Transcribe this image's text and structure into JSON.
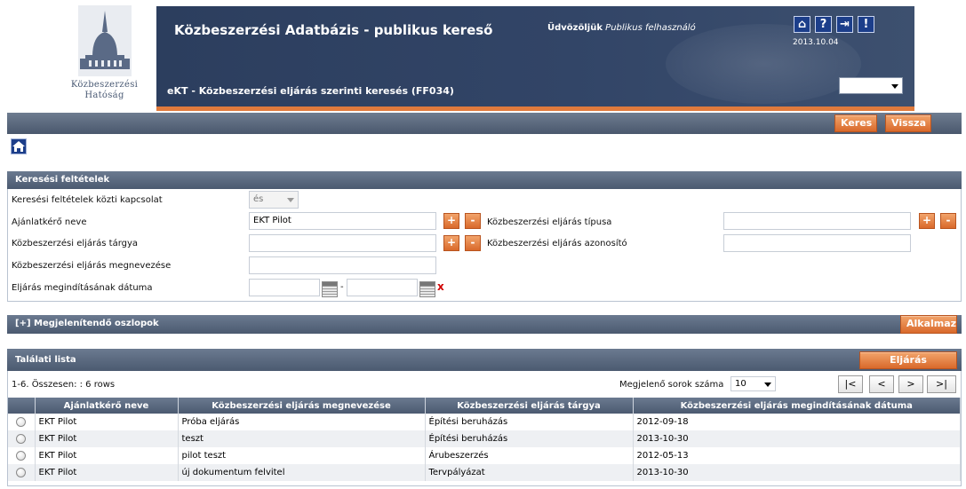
{
  "logo": {
    "line1": "Közbeszerzési",
    "line2": "Hatóság"
  },
  "header": {
    "title": "Közbeszerzési Adatbázis - publikus kereső",
    "welcome_label": "Üdvözöljük",
    "welcome_user": "Publikus felhasználó",
    "date": "2013.10.04",
    "subtitle": "eKT - Közbeszerzési eljárás szerinti keresés (FF034)",
    "icons": [
      "home-icon",
      "help-icon",
      "logout-icon",
      "alert-icon"
    ],
    "icon_glyphs": [
      "⌂",
      "?",
      "⇥",
      "!"
    ],
    "language_select_value": ""
  },
  "toolbar": {
    "search_label": "Keres",
    "back_label": "Vissza"
  },
  "criteria": {
    "title": "Keresési feltételek",
    "relation_label": "Keresési feltételek közti kapcsolat",
    "relation_value": "és",
    "contracting_label": "Ajánlatkérő neve",
    "contracting_value": "EKT Pilot",
    "procedure_type_label": "Közbeszerzési eljárás típusa",
    "procedure_type_value": "",
    "subject_label": "Közbeszerzési eljárás tárgya",
    "subject_value": "",
    "procedure_id_label": "Közbeszerzési eljárás azonosító",
    "procedure_id_value": "",
    "name_label": "Közbeszerzési eljárás megnevezése",
    "name_value": "",
    "start_date_label": "Eljárás megindításának dátuma",
    "date_from": "",
    "date_to": "",
    "date_separator": "-",
    "clear_glyph": "x",
    "plus_glyph": "+",
    "minus_glyph": "-"
  },
  "columns_panel": {
    "title": "[+] Megjelenítendő oszlopok",
    "apply_label": "Alkalmaz"
  },
  "results": {
    "title": "Találati lista",
    "detail_button": "Eljárás adatlapja",
    "summary": "1-6. Összesen: : 6 rows",
    "rows_per_page_label": "Megjelenő sorok száma",
    "rows_per_page_value": "10",
    "pager": [
      "|<",
      "<",
      ">",
      ">|"
    ],
    "columns": [
      "Ajánlatkérő neve",
      "Közbeszerzési eljárás megnevezése",
      "Közbeszerzési eljárás tárgya",
      "Közbeszerzési eljárás megindításának dátuma"
    ],
    "rows": [
      [
        "EKT Pilot",
        "Próba eljárás",
        "Építési beruházás",
        "2012-09-18"
      ],
      [
        "EKT Pilot",
        "teszt",
        "Építési beruházás",
        "2013-10-30"
      ],
      [
        "EKT Pilot",
        "pilot teszt",
        "Árubeszerzés",
        "2012-05-13"
      ],
      [
        "EKT Pilot",
        "új dokumentum felvitel",
        "Tervpályázat",
        "2013-10-30"
      ]
    ]
  },
  "colors": {
    "accent": "#d9692b",
    "header_bg": "#324567",
    "bar_bg": "#4b5a70"
  }
}
